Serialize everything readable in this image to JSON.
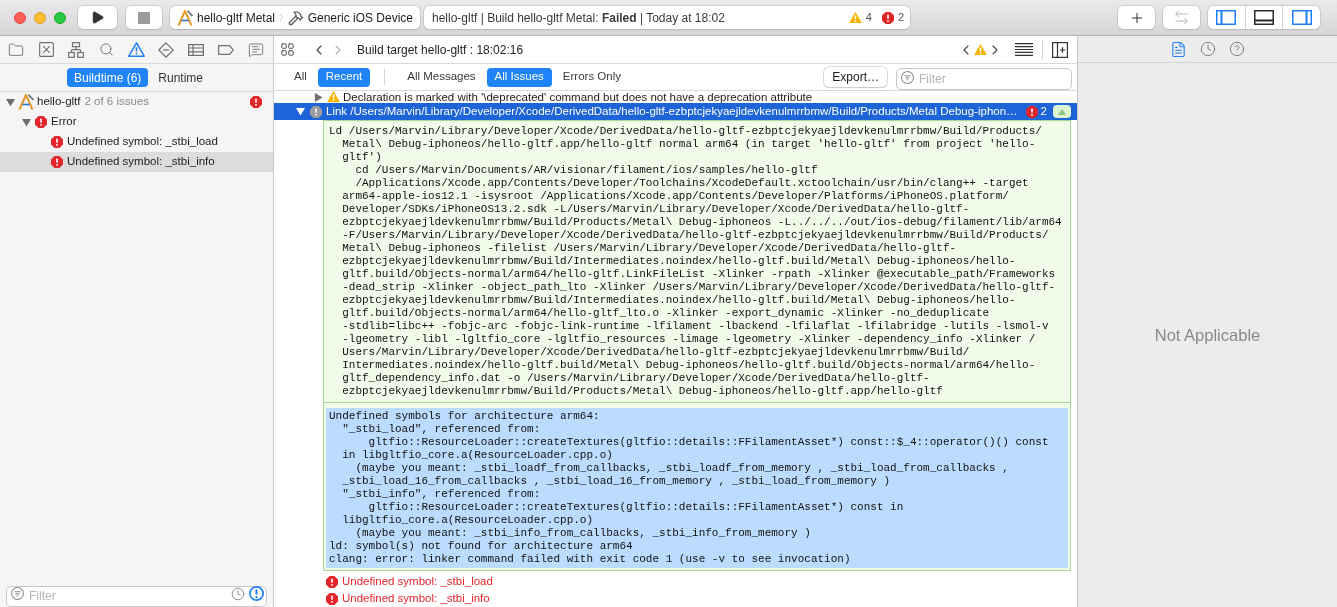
{
  "toolbar": {
    "stop_button": {
      "disabled": true
    },
    "scheme": {
      "target": "hello-gltf Metal",
      "destination": "Generic iOS Device"
    },
    "activity": {
      "status": "hello-gltf | Build hello-gltf Metal: **Failed** | Today at 18:02",
      "warnings": "4",
      "errors": "2"
    },
    "swap_button": {
      "disabled": true
    },
    "panel_toggles": [
      {
        "kind": "navigator",
        "selected": true
      },
      {
        "kind": "debug",
        "selected": false
      },
      {
        "kind": "inspector",
        "selected": true
      }
    ]
  },
  "navigator": {
    "tabs": [
      {
        "kind": "project",
        "selected": false
      },
      {
        "kind": "source-control",
        "selected": false
      },
      {
        "kind": "symbol",
        "selected": false
      },
      {
        "kind": "find",
        "selected": false
      },
      {
        "kind": "issue",
        "selected": true
      },
      {
        "kind": "test",
        "selected": false
      },
      {
        "kind": "debug",
        "selected": false
      },
      {
        "kind": "breakpoint",
        "selected": false
      },
      {
        "kind": "report",
        "selected": false
      }
    ],
    "scope": [
      {
        "label": "Buildtime (6)",
        "selected": true
      },
      {
        "label": "Runtime",
        "selected": false
      }
    ],
    "tree": [
      {
        "kind": "project",
        "label": "hello-gltf",
        "detail": "2 of 6 issues",
        "error_badge": true,
        "expanded": true,
        "selected": false,
        "children": [
          {
            "kind": "error-group",
            "label": "Error",
            "expanded": true,
            "selected": false,
            "children": [
              {
                "kind": "error",
                "label": "Undefined symbol: _stbi_load",
                "selected": false
              },
              {
                "kind": "error",
                "label": "Undefined symbol: _stbi_info",
                "selected": true
              }
            ]
          }
        ]
      }
    ],
    "filter": {
      "placeholder": "Filter"
    },
    "filter_modes": [
      {
        "kind": "recent",
        "selected": false
      },
      {
        "kind": "issues",
        "selected": true
      }
    ]
  },
  "editor": {
    "jump_bar": {
      "title": "Build target hello-gltf : 18:02:16"
    },
    "time_filters": [
      {
        "label": "All",
        "selected": false
      },
      {
        "label": "Recent",
        "selected": true
      }
    ],
    "message_filters": [
      {
        "label": "All Messages",
        "selected": false
      },
      {
        "label": "All Issues",
        "selected": true
      },
      {
        "label": "Errors Only",
        "selected": false
      }
    ],
    "export_button": "Export…",
    "filter": {
      "placeholder": "Filter"
    },
    "previous_message": {
      "kind": "warning",
      "expanded": false,
      "text": "Declaration is marked with '\\deprecated' command but does not have a deprecation attribute"
    },
    "build_step": {
      "kind": "note",
      "title": "Link /Users/Marvin/Library/Developer/Xcode/DerivedData/hello-gltf-ezbptcjekyaejldevkenulmrrbmw/Build/Products/Metal Debug-iphon…",
      "error_count": "2",
      "expanded": true,
      "selected": true,
      "command": [
        "Ld /Users/Marvin/Library/Developer/Xcode/DerivedData/hello-gltf-ezbptcjekyaejldevkenulmrrbmw/Build/Products/",
        "  Metal\\ Debug-iphoneos/hello-gltf.app/hello-gltf normal arm64 (in target 'hello-gltf' from project 'hello-",
        "  gltf')",
        "    cd /Users/Marvin/Documents/AR/visionar/filament/ios/samples/hello-gltf",
        "    /Applications/Xcode.app/Contents/Developer/Toolchains/XcodeDefault.xctoolchain/usr/bin/clang++ -target",
        "  arm64-apple-ios12.1 -isysroot /Applications/Xcode.app/Contents/Developer/Platforms/iPhoneOS.platform/",
        "  Developer/SDKs/iPhoneOS13.2.sdk -L/Users/Marvin/Library/Developer/Xcode/DerivedData/hello-gltf-",
        "  ezbptcjekyaejldevkenulmrrbmw/Build/Products/Metal\\ Debug-iphoneos -L../../../out/ios-debug/filament/lib/arm64",
        "  -F/Users/Marvin/Library/Developer/Xcode/DerivedData/hello-gltf-ezbptcjekyaejldevkenulmrrbmw/Build/Products/",
        "  Metal\\ Debug-iphoneos -filelist /Users/Marvin/Library/Developer/Xcode/DerivedData/hello-gltf-",
        "  ezbptcjekyaejldevkenulmrrbmw/Build/Intermediates.noindex/hello-gltf.build/Metal\\ Debug-iphoneos/hello-",
        "  gltf.build/Objects-normal/arm64/hello-gltf.LinkFileList -Xlinker -rpath -Xlinker @executable_path/Frameworks",
        "  -dead_strip -Xlinker -object_path_lto -Xlinker /Users/Marvin/Library/Developer/Xcode/DerivedData/hello-gltf-",
        "  ezbptcjekyaejldevkenulmrrbmw/Build/Intermediates.noindex/hello-gltf.build/Metal\\ Debug-iphoneos/hello-",
        "  gltf.build/Objects-normal/arm64/hello-gltf_lto.o -Xlinker -export_dynamic -Xlinker -no_deduplicate",
        "  -stdlib=libc++ -fobjc-arc -fobjc-link-runtime -lfilament -lbackend -lfilaflat -lfilabridge -lutils -lsmol-v",
        "  -lgeometry -libl -lgltfio_core -lgltfio_resources -limage -lgeometry -Xlinker -dependency_info -Xlinker /",
        "  Users/Marvin/Library/Developer/Xcode/DerivedData/hello-gltf-ezbptcjekyaejldevkenulmrrbmw/Build/",
        "  Intermediates.noindex/hello-gltf.build/Metal\\ Debug-iphoneos/hello-gltf.build/Objects-normal/arm64/hello-",
        "  gltf_dependency_info.dat -o /Users/Marvin/Library/Developer/Xcode/DerivedData/hello-gltf-",
        "  ezbptcjekyaejldevkenulmrrbmw/Build/Products/Metal\\ Debug-iphoneos/hello-gltf.app/hello-gltf"
      ],
      "output": [
        "Undefined symbols for architecture arm64:",
        "  \"_stbi_load\", referenced from:",
        "      gltfio::ResourceLoader::createTextures(gltfio::details::FFilamentAsset*) const::$_4::operator()() const",
        "  in libgltfio_core.a(ResourceLoader.cpp.o)",
        "    (maybe you meant: _stbi_loadf_from_callbacks, _stbi_loadf_from_memory , _stbi_load_from_callbacks ,",
        "  _stbi_load_16_from_callbacks , _stbi_load_16_from_memory , _stbi_load_from_memory )",
        "  \"_stbi_info\", referenced from:",
        "      gltfio::ResourceLoader::createTextures(gltfio::details::FFilamentAsset*) const in",
        "  libgltfio_core.a(ResourceLoader.cpp.o)",
        "    (maybe you meant: _stbi_info_from_callbacks, _stbi_info_from_memory )",
        "ld: symbol(s) not found for architecture arm64",
        "clang: error: linker command failed with exit code 1 (use -v to see invocation)"
      ],
      "output_selected": true
    },
    "issues": [
      {
        "kind": "error",
        "text": "Undefined symbol: _stbi_load"
      },
      {
        "kind": "error",
        "text": "Undefined symbol: _stbi_info"
      }
    ]
  },
  "inspector": {
    "tabs": [
      {
        "kind": "file",
        "selected": true
      },
      {
        "kind": "history",
        "selected": false
      },
      {
        "kind": "help",
        "selected": false
      }
    ],
    "message": "Not Applicable"
  }
}
